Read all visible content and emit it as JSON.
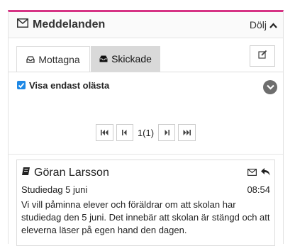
{
  "header": {
    "title": "Meddelanden",
    "hide_label": "Dölj"
  },
  "tabs": [
    {
      "label": "Mottagna",
      "active": true
    },
    {
      "label": "Skickade",
      "active": false
    }
  ],
  "filter": {
    "label": "Visa endast olästa",
    "checked": true
  },
  "pager": {
    "page_text": "1(1)"
  },
  "message": {
    "sender": "Göran Larsson",
    "subject": "Studiedag 5 juni",
    "time": "08:54",
    "body": "Vi vill påminna elever och föräldrar om att skolan har studiedag den 5 juni. Det innebär att skolan är stängd och att eleverna läser på egen hand den dagen."
  },
  "colors": {
    "accent": "#d63384",
    "checkbox": "#1e88e5",
    "tab_inactive": "#d9d9d9"
  }
}
